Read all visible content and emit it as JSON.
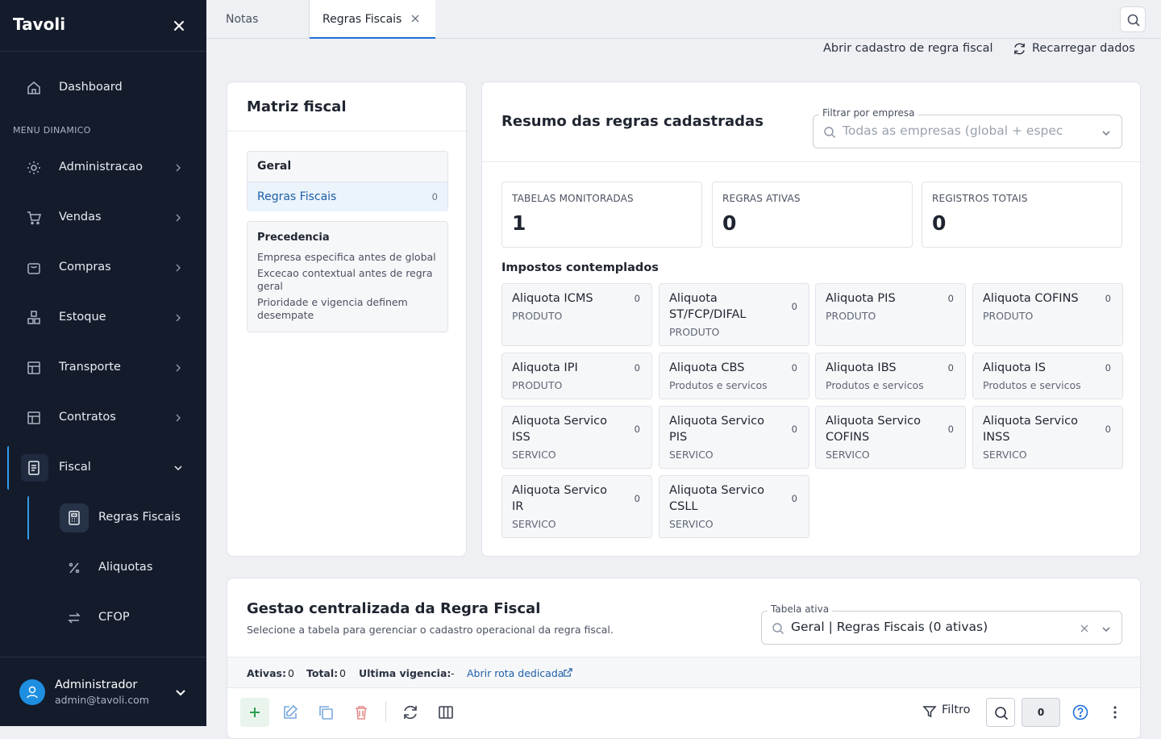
{
  "brand": "Tavoli",
  "sidebar": {
    "dashboard": "Dashboard",
    "section_label": "MENU DINAMICO",
    "items": [
      "Administracao",
      "Vendas",
      "Compras",
      "Estoque",
      "Transporte",
      "Contratos",
      "Fiscal"
    ],
    "sub_items": [
      "Regras Fiscais",
      "Aliquotas",
      "CFOP"
    ],
    "user": {
      "name": "Administrador",
      "email": "admin@tavoli.com"
    }
  },
  "tabs": [
    "Notas",
    "Regras Fiscais"
  ],
  "actions": {
    "open_cadastro": "Abrir cadastro de regra fiscal",
    "reload": "Recarregar dados"
  },
  "matriz": {
    "title": "Matriz fiscal",
    "group": "Geral",
    "row_label": "Regras Fiscais",
    "row_count": "0",
    "precedencia": {
      "title": "Precedencia",
      "lines": [
        "Empresa especifica antes de global",
        "Excecao contextual antes de regra geral",
        "Prioridade e vigencia definem desempate"
      ]
    }
  },
  "resumo": {
    "title": "Resumo das regras cadastradas",
    "filter_label": "Filtrar por empresa",
    "filter_placeholder": "Todas as empresas (global + espec",
    "stats": [
      {
        "label": "TABELAS MONITORADAS",
        "value": "1"
      },
      {
        "label": "REGRAS ATIVAS",
        "value": "0"
      },
      {
        "label": "REGISTROS TOTAIS",
        "value": "0"
      }
    ],
    "impostos_title": "Impostos contemplados",
    "impostos": [
      {
        "name": "Aliquota ICMS",
        "sub": "PRODUTO",
        "count": "0"
      },
      {
        "name": "Aliquota ST/FCP/DIFAL",
        "sub": "PRODUTO",
        "count": "0"
      },
      {
        "name": "Aliquota PIS",
        "sub": "PRODUTO",
        "count": "0"
      },
      {
        "name": "Aliquota COFINS",
        "sub": "PRODUTO",
        "count": "0"
      },
      {
        "name": "Aliquota IPI",
        "sub": "PRODUTO",
        "count": "0"
      },
      {
        "name": "Aliquota CBS",
        "sub": "Produtos e servicos",
        "count": "0"
      },
      {
        "name": "Aliquota IBS",
        "sub": "Produtos e servicos",
        "count": "0"
      },
      {
        "name": "Aliquota IS",
        "sub": "Produtos e servicos",
        "count": "0"
      },
      {
        "name": "Aliquota Servico ISS",
        "sub": "SERVICO",
        "count": "0"
      },
      {
        "name": "Aliquota Servico PIS",
        "sub": "SERVICO",
        "count": "0"
      },
      {
        "name": "Aliquota Servico COFINS",
        "sub": "SERVICO",
        "count": "0"
      },
      {
        "name": "Aliquota Servico INSS",
        "sub": "SERVICO",
        "count": "0"
      },
      {
        "name": "Aliquota Servico IR",
        "sub": "SERVICO",
        "count": "0"
      },
      {
        "name": "Aliquota Servico CSLL",
        "sub": "SERVICO",
        "count": "0"
      }
    ]
  },
  "gestao": {
    "title": "Gestao centralizada da Regra Fiscal",
    "subtitle": "Selecione a tabela para gerenciar o cadastro operacional da regra fiscal.",
    "table_label": "Tabela ativa",
    "table_value": "Geral | Regras Fiscais (0 ativas)",
    "ativas_label": "Ativas:",
    "ativas_value": "0",
    "total_label": "Total:",
    "total_value": "0",
    "vigencia_label": "Ultima vigencia:",
    "vigencia_value": "-",
    "route_link": "Abrir rota dedicada",
    "filter_label": "Filtro",
    "count_badge": "0"
  },
  "colors": {
    "accent": "#1e6fd9",
    "sidebar_bg": "#141c2c",
    "active_bar": "#2f9be8"
  }
}
